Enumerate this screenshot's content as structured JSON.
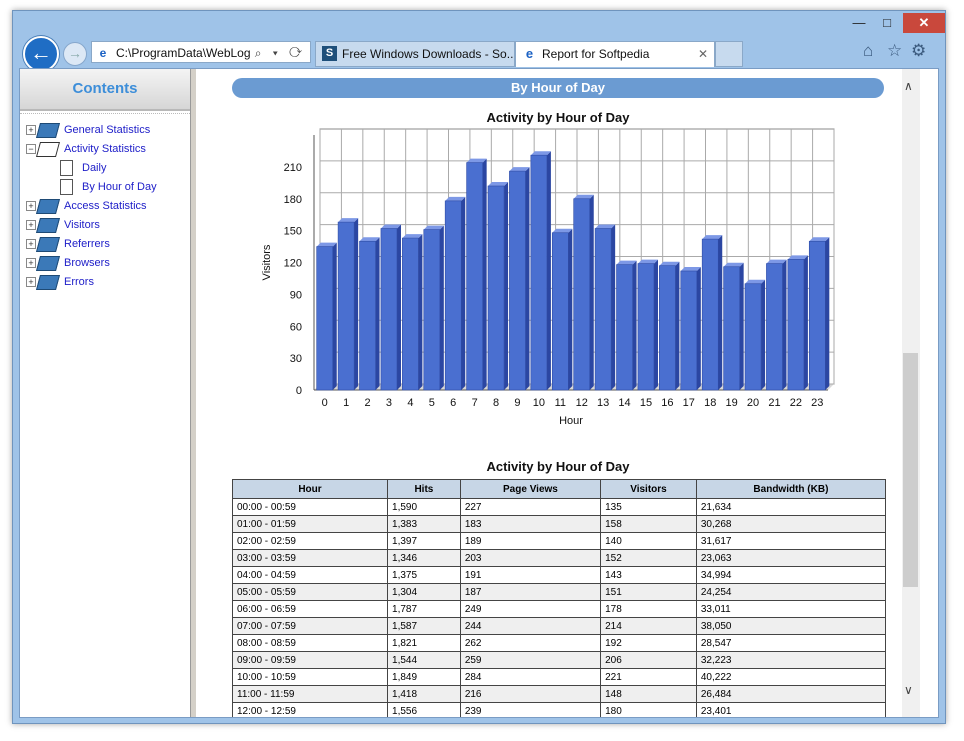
{
  "window": {
    "minimize_glyph": "—",
    "maximize_glyph": "□",
    "close_glyph": "✕"
  },
  "nav": {
    "back_glyph": "←",
    "forward_glyph": "→",
    "address": "C:\\ProgramData\\WebLog",
    "address_tools": "⌕ ▾ ⟳"
  },
  "tabs": [
    {
      "icon": "S",
      "label": "Free Windows Downloads - So..."
    },
    {
      "icon": "e",
      "label": "Report for Softpedia",
      "close": "✕"
    }
  ],
  "toolbar_icons": {
    "home": "⌂",
    "favorites": "☆",
    "tools": "⚙"
  },
  "sidebar": {
    "header": "Contents",
    "items": [
      {
        "label": "General Statistics",
        "expander": "+",
        "icon": "book"
      },
      {
        "label": "Activity Statistics",
        "expander": "−",
        "icon": "book-open"
      },
      {
        "label": "Daily",
        "expander": "",
        "icon": "page"
      },
      {
        "label": "By Hour of Day",
        "expander": "",
        "icon": "page"
      },
      {
        "label": "Access Statistics",
        "expander": "+",
        "icon": "book"
      },
      {
        "label": "Visitors",
        "expander": "+",
        "icon": "book"
      },
      {
        "label": "Referrers",
        "expander": "+",
        "icon": "book"
      },
      {
        "label": "Browsers",
        "expander": "+",
        "icon": "book"
      },
      {
        "label": "Errors",
        "expander": "+",
        "icon": "book"
      }
    ]
  },
  "main": {
    "banner": "By Hour of Day",
    "chart_title": "Activity by Hour of Day",
    "table_title": "Activity by Hour of Day"
  },
  "chart_data": {
    "type": "bar",
    "title": "Activity by Hour of Day",
    "xlabel": "Hour",
    "ylabel": "Visitors",
    "ylim": [
      0,
      240
    ],
    "yticks": [
      0,
      30,
      60,
      90,
      120,
      150,
      180,
      210
    ],
    "grid": true,
    "bar_color": "#4a6fd0",
    "categories": [
      "0",
      "1",
      "2",
      "3",
      "4",
      "5",
      "6",
      "7",
      "8",
      "9",
      "10",
      "11",
      "12",
      "13",
      "14",
      "15",
      "16",
      "17",
      "18",
      "19",
      "20",
      "21",
      "22",
      "23"
    ],
    "values": [
      135,
      158,
      140,
      152,
      143,
      151,
      178,
      214,
      192,
      206,
      221,
      148,
      180,
      152,
      118,
      119,
      117,
      112,
      142,
      116,
      100,
      119,
      123,
      140
    ]
  },
  "table": {
    "headers": [
      "Hour",
      "Hits",
      "Page Views",
      "Visitors",
      "Bandwidth (KB)"
    ],
    "rows": [
      [
        "00:00 - 00:59",
        "1,590",
        "227",
        "135",
        "21,634"
      ],
      [
        "01:00 - 01:59",
        "1,383",
        "183",
        "158",
        "30,268"
      ],
      [
        "02:00 - 02:59",
        "1,397",
        "189",
        "140",
        "31,617"
      ],
      [
        "03:00 - 03:59",
        "1,346",
        "203",
        "152",
        "23,063"
      ],
      [
        "04:00 - 04:59",
        "1,375",
        "191",
        "143",
        "34,994"
      ],
      [
        "05:00 - 05:59",
        "1,304",
        "187",
        "151",
        "24,254"
      ],
      [
        "06:00 - 06:59",
        "1,787",
        "249",
        "178",
        "33,011"
      ],
      [
        "07:00 - 07:59",
        "1,587",
        "244",
        "214",
        "38,050"
      ],
      [
        "08:00 - 08:59",
        "1,821",
        "262",
        "192",
        "28,547"
      ],
      [
        "09:00 - 09:59",
        "1,544",
        "259",
        "206",
        "32,223"
      ],
      [
        "10:00 - 10:59",
        "1,849",
        "284",
        "221",
        "40,222"
      ],
      [
        "11:00 - 11:59",
        "1,418",
        "216",
        "148",
        "26,484"
      ],
      [
        "12:00 - 12:59",
        "1,556",
        "239",
        "180",
        "23,401"
      ]
    ]
  },
  "scrollbar": {
    "up": "∧",
    "down": "∨"
  }
}
